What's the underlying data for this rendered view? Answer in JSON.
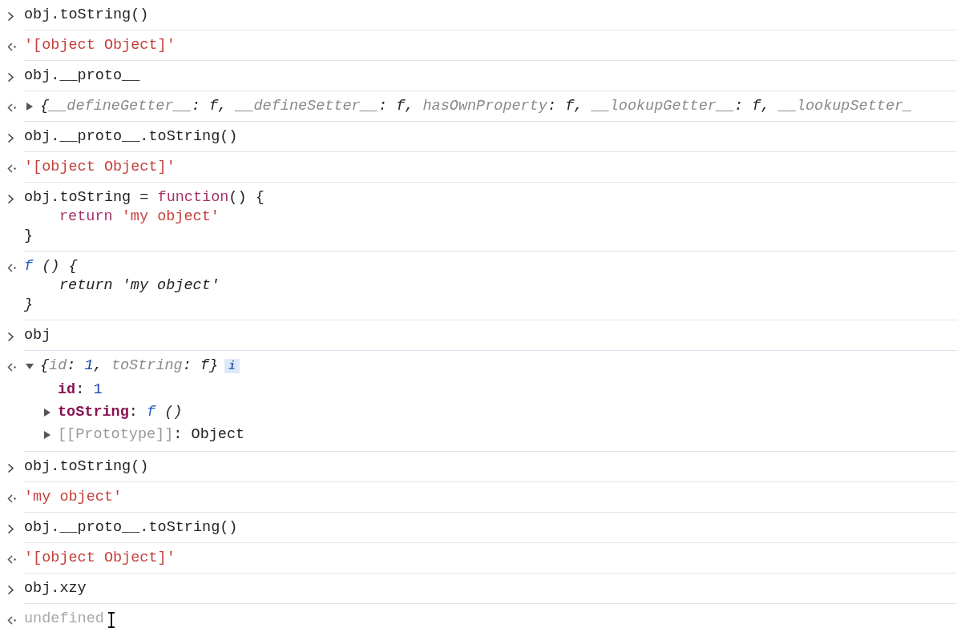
{
  "entries": [
    {
      "kind": "input",
      "lines": [
        {
          "tokens": [
            {
              "text": "obj.toString()",
              "kind": "plain"
            }
          ]
        }
      ]
    },
    {
      "kind": "output",
      "lines": [
        {
          "tokens": [
            {
              "text": "'[object Object]'",
              "kind": "string"
            }
          ]
        }
      ]
    },
    {
      "kind": "input",
      "lines": [
        {
          "tokens": [
            {
              "text": "obj.__proto__",
              "kind": "plain"
            }
          ]
        }
      ]
    },
    {
      "kind": "object",
      "expanded": false,
      "preview": [
        {
          "text": "{",
          "kind": "punct"
        },
        {
          "text": "__defineGetter__",
          "kind": "key"
        },
        {
          "text": ": ",
          "kind": "punct"
        },
        {
          "text": "f",
          "kind": "punct"
        },
        {
          "text": ", ",
          "kind": "punct"
        },
        {
          "text": "__defineSetter__",
          "kind": "key"
        },
        {
          "text": ": ",
          "kind": "punct"
        },
        {
          "text": "f",
          "kind": "punct"
        },
        {
          "text": ", ",
          "kind": "punct"
        },
        {
          "text": "hasOwnProperty",
          "kind": "key"
        },
        {
          "text": ": ",
          "kind": "punct"
        },
        {
          "text": "f",
          "kind": "punct"
        },
        {
          "text": ", ",
          "kind": "punct"
        },
        {
          "text": "__lookupGetter__",
          "kind": "key"
        },
        {
          "text": ": ",
          "kind": "punct"
        },
        {
          "text": "f",
          "kind": "punct"
        },
        {
          "text": ", ",
          "kind": "punct"
        },
        {
          "text": "__lookupSetter_",
          "kind": "key"
        }
      ]
    },
    {
      "kind": "input",
      "lines": [
        {
          "tokens": [
            {
              "text": "obj.__proto__.toString()",
              "kind": "plain"
            }
          ]
        }
      ]
    },
    {
      "kind": "output",
      "lines": [
        {
          "tokens": [
            {
              "text": "'[object Object]'",
              "kind": "string"
            }
          ]
        }
      ]
    },
    {
      "kind": "input",
      "lines": [
        {
          "tokens": [
            {
              "text": "obj.toString = ",
              "kind": "plain"
            },
            {
              "text": "function",
              "kind": "keyword"
            },
            {
              "text": "() {",
              "kind": "plain"
            }
          ],
          "children": [
            {
              "tokens": [
                {
                  "text": "return ",
                  "kind": "keyword"
                },
                {
                  "text": "'my object'",
                  "kind": "string"
                }
              ]
            }
          ]
        },
        {
          "tokens": [
            {
              "text": "}",
              "kind": "plain"
            }
          ]
        }
      ]
    },
    {
      "kind": "output",
      "lines": [
        {
          "tokens": [
            {
              "text": "f",
              "kind": "fn"
            },
            {
              "text": " () {",
              "kind": "punct"
            }
          ],
          "children": [
            {
              "tokens": [
                {
                  "text": "return 'my object'",
                  "kind": "punct"
                }
              ]
            }
          ]
        },
        {
          "tokens": [
            {
              "text": "}",
              "kind": "punct"
            }
          ]
        }
      ]
    },
    {
      "kind": "input",
      "lines": [
        {
          "tokens": [
            {
              "text": "obj",
              "kind": "plain"
            }
          ]
        }
      ]
    },
    {
      "kind": "object",
      "expanded": true,
      "badge": "i",
      "preview": [
        {
          "text": "{",
          "kind": "punct"
        },
        {
          "text": "id",
          "kind": "key"
        },
        {
          "text": ": ",
          "kind": "punct"
        },
        {
          "text": "1",
          "kind": "numi"
        },
        {
          "text": ", ",
          "kind": "punct"
        },
        {
          "text": "toString",
          "kind": "key"
        },
        {
          "text": ": ",
          "kind": "punct"
        },
        {
          "text": "f",
          "kind": "punct"
        },
        {
          "text": "}",
          "kind": "punct"
        }
      ],
      "children": [
        {
          "expandable": false,
          "tokens": [
            {
              "text": "id",
              "kind": "prop"
            },
            {
              "text": ": ",
              "kind": "plain"
            },
            {
              "text": "1",
              "kind": "number"
            }
          ]
        },
        {
          "expandable": true,
          "expanded": false,
          "tokens": [
            {
              "text": "toString",
              "kind": "prop"
            },
            {
              "text": ": ",
              "kind": "plain"
            },
            {
              "text": "f",
              "kind": "fn"
            },
            {
              "text": " ()",
              "kind": "punct"
            }
          ]
        },
        {
          "expandable": true,
          "expanded": false,
          "tokens": [
            {
              "text": "[[Prototype]]",
              "kind": "dim"
            },
            {
              "text": ": Object",
              "kind": "plain"
            }
          ]
        }
      ]
    },
    {
      "kind": "input",
      "lines": [
        {
          "tokens": [
            {
              "text": "obj.toString()",
              "kind": "plain"
            }
          ]
        }
      ]
    },
    {
      "kind": "output",
      "lines": [
        {
          "tokens": [
            {
              "text": "'my object'",
              "kind": "string"
            }
          ]
        }
      ]
    },
    {
      "kind": "input",
      "lines": [
        {
          "tokens": [
            {
              "text": "obj.__proto__.toString()",
              "kind": "plain"
            }
          ]
        }
      ]
    },
    {
      "kind": "output",
      "lines": [
        {
          "tokens": [
            {
              "text": "'[object Object]'",
              "kind": "string"
            }
          ]
        }
      ]
    },
    {
      "kind": "input",
      "lines": [
        {
          "tokens": [
            {
              "text": "obj.xzy",
              "kind": "plain"
            }
          ]
        }
      ]
    },
    {
      "kind": "output",
      "lines": [
        {
          "tokens": [
            {
              "text": "undefined",
              "kind": "undef"
            }
          ]
        }
      ]
    }
  ]
}
